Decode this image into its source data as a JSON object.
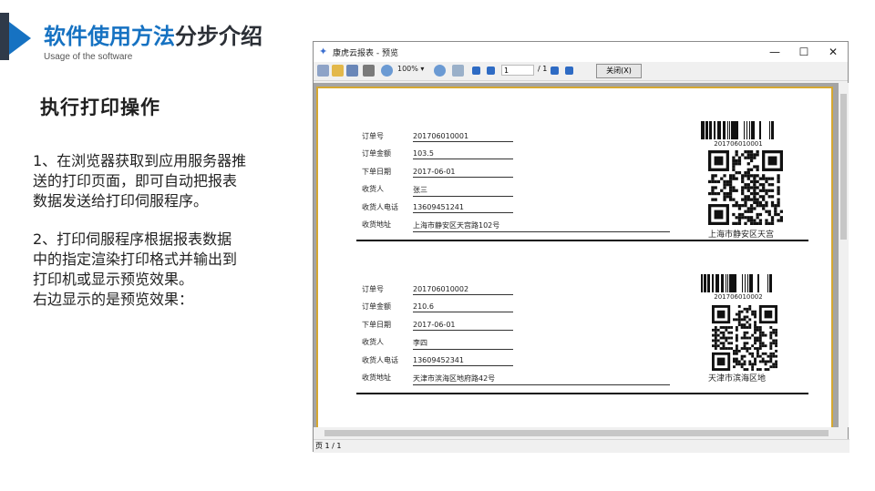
{
  "header": {
    "title_blue": "软件使用方法",
    "title_dark": "分步介绍",
    "subtitle": "Usage of the software"
  },
  "section_title": "执行打印操作",
  "para1_lines": [
    "1、在浏览器获取到应用服务器推",
    "送的打印页面，即可自动把报表",
    "数据发送给打印伺服程序。"
  ],
  "para2_lines": [
    "2、打印伺服程序根据报表数据",
    "中的指定渲染打印格式并输出到",
    "打印机或显示预览效果。",
    "右边显示的是预览效果："
  ],
  "window": {
    "title": "康虎云报表 - 预览",
    "minimize": "—",
    "maximize": "☐",
    "close": "✕",
    "zoom": "100%",
    "page_current": "1",
    "page_total": "/ 1",
    "close_button": "关闭(X)",
    "status": "页 1 / 1"
  },
  "records": [
    {
      "labels": [
        "订单号",
        "订单金额",
        "下单日期",
        "收货人",
        "收货人电话",
        "收货地址"
      ],
      "values": [
        "201706010001",
        "103.5",
        "2017-06-01",
        "张三",
        "13609451241",
        "上海市静安区天宫路102号"
      ],
      "barcode_number": "201706010001",
      "qr_caption": "上海市静安区天宫"
    },
    {
      "labels": [
        "订单号",
        "订单金额",
        "下单日期",
        "收货人",
        "收货人电话",
        "收货地址"
      ],
      "values": [
        "201706010002",
        "210.6",
        "2017-06-01",
        "李四",
        "13609452341",
        "天津市滨海区地府路42号"
      ],
      "barcode_number": "201706010002",
      "qr_caption": "天津市滨海区地"
    }
  ],
  "colors": {
    "accent": "#1672c2",
    "dark_bar": "#2f3a49",
    "paper_border": "#d6a830"
  }
}
